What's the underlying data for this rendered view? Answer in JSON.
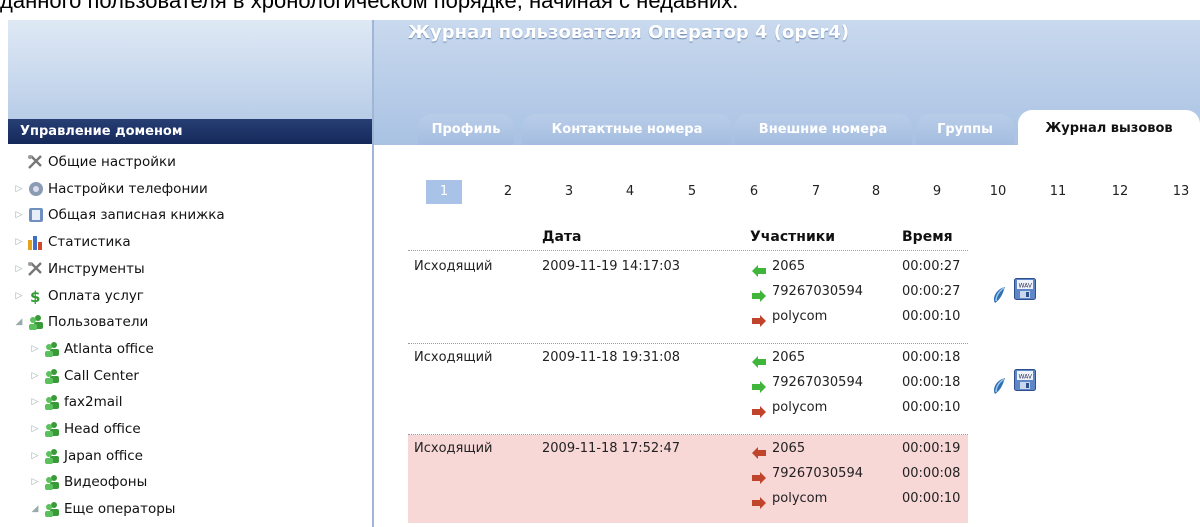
{
  "caption": "данного пользователя в хронологическом порядке, начиная с недавних.",
  "sidebar": {
    "title": "Управление доменом",
    "items": [
      {
        "label": "Общие настройки",
        "icon": "tools-icon",
        "indent": 0,
        "exp": ""
      },
      {
        "label": "Настройки телефонии",
        "icon": "phone-settings-icon",
        "indent": 0,
        "exp": "▷"
      },
      {
        "label": "Общая записная книжка",
        "icon": "address-book-icon",
        "indent": 0,
        "exp": "▷"
      },
      {
        "label": "Статистика",
        "icon": "statistics-icon",
        "indent": 0,
        "exp": "▷"
      },
      {
        "label": "Инструменты",
        "icon": "tools-icon",
        "indent": 0,
        "exp": "▷"
      },
      {
        "label": "Оплата услуг",
        "icon": "dollar-icon",
        "indent": 0,
        "exp": "▷"
      },
      {
        "label": "Пользователи",
        "icon": "users-icon",
        "indent": 0,
        "exp": "◢"
      },
      {
        "label": "Atlanta office",
        "icon": "users-icon",
        "indent": 1,
        "exp": "▷"
      },
      {
        "label": "Call Center",
        "icon": "users-icon",
        "indent": 1,
        "exp": "▷"
      },
      {
        "label": "fax2mail",
        "icon": "users-icon",
        "indent": 1,
        "exp": "▷"
      },
      {
        "label": "Head office",
        "icon": "users-icon",
        "indent": 1,
        "exp": "▷"
      },
      {
        "label": "Japan office",
        "icon": "users-icon",
        "indent": 1,
        "exp": "▷"
      },
      {
        "label": "Видеофоны",
        "icon": "users-icon",
        "indent": 1,
        "exp": "▷"
      },
      {
        "label": "Еще операторы",
        "icon": "users-icon",
        "indent": 1,
        "exp": "◢"
      }
    ]
  },
  "header": {
    "title": "Журнал пользователя Оператор 4 (oper4)",
    "tabs": [
      {
        "label": "Профиль",
        "active": false
      },
      {
        "label": "Контактные номера",
        "active": false
      },
      {
        "label": "Внешние номера",
        "active": false
      },
      {
        "label": "Группы",
        "active": false
      },
      {
        "label": "Журнал вызовов",
        "active": true
      }
    ]
  },
  "pagination": {
    "current": "1",
    "pages": [
      "1",
      "2",
      "3",
      "4",
      "5",
      "6",
      "7",
      "8",
      "9",
      "10",
      "11",
      "12",
      "13"
    ]
  },
  "table": {
    "headers": {
      "date": "Дата",
      "participants": "Участники",
      "time": "Время"
    },
    "calls": [
      {
        "type": "Исходящий",
        "date": "2009-11-19 14:17:03",
        "highlight": false,
        "has_recording": true,
        "participants": [
          {
            "name": "2065",
            "time": "00:00:27",
            "icon": "arrow-left-green-icon"
          },
          {
            "name": "79267030594",
            "time": "00:00:27",
            "icon": "arrow-right-green-icon"
          },
          {
            "name": "polycom",
            "time": "00:00:10",
            "icon": "arrow-right-red-icon"
          }
        ]
      },
      {
        "type": "Исходящий",
        "date": "2009-11-18 19:31:08",
        "highlight": false,
        "has_recording": true,
        "participants": [
          {
            "name": "2065",
            "time": "00:00:18",
            "icon": "arrow-left-green-icon"
          },
          {
            "name": "79267030594",
            "time": "00:00:18",
            "icon": "arrow-right-green-icon"
          },
          {
            "name": "polycom",
            "time": "00:00:10",
            "icon": "arrow-right-red-icon"
          }
        ]
      },
      {
        "type": "Исходящий",
        "date": "2009-11-18 17:52:47",
        "highlight": true,
        "has_recording": false,
        "participants": [
          {
            "name": "2065",
            "time": "00:00:19",
            "icon": "arrow-left-red-icon"
          },
          {
            "name": "79267030594",
            "time": "00:00:08",
            "icon": "arrow-right-red-icon"
          },
          {
            "name": "polycom",
            "time": "00:00:10",
            "icon": "arrow-right-red-icon"
          }
        ]
      }
    ]
  },
  "colors": {
    "sidebar_bar": "#1d3366",
    "header_bg": "#b9cde8",
    "missed_row": "#f8d7d7",
    "green_arrow": "#3fb63a",
    "red_arrow": "#c0442b"
  }
}
